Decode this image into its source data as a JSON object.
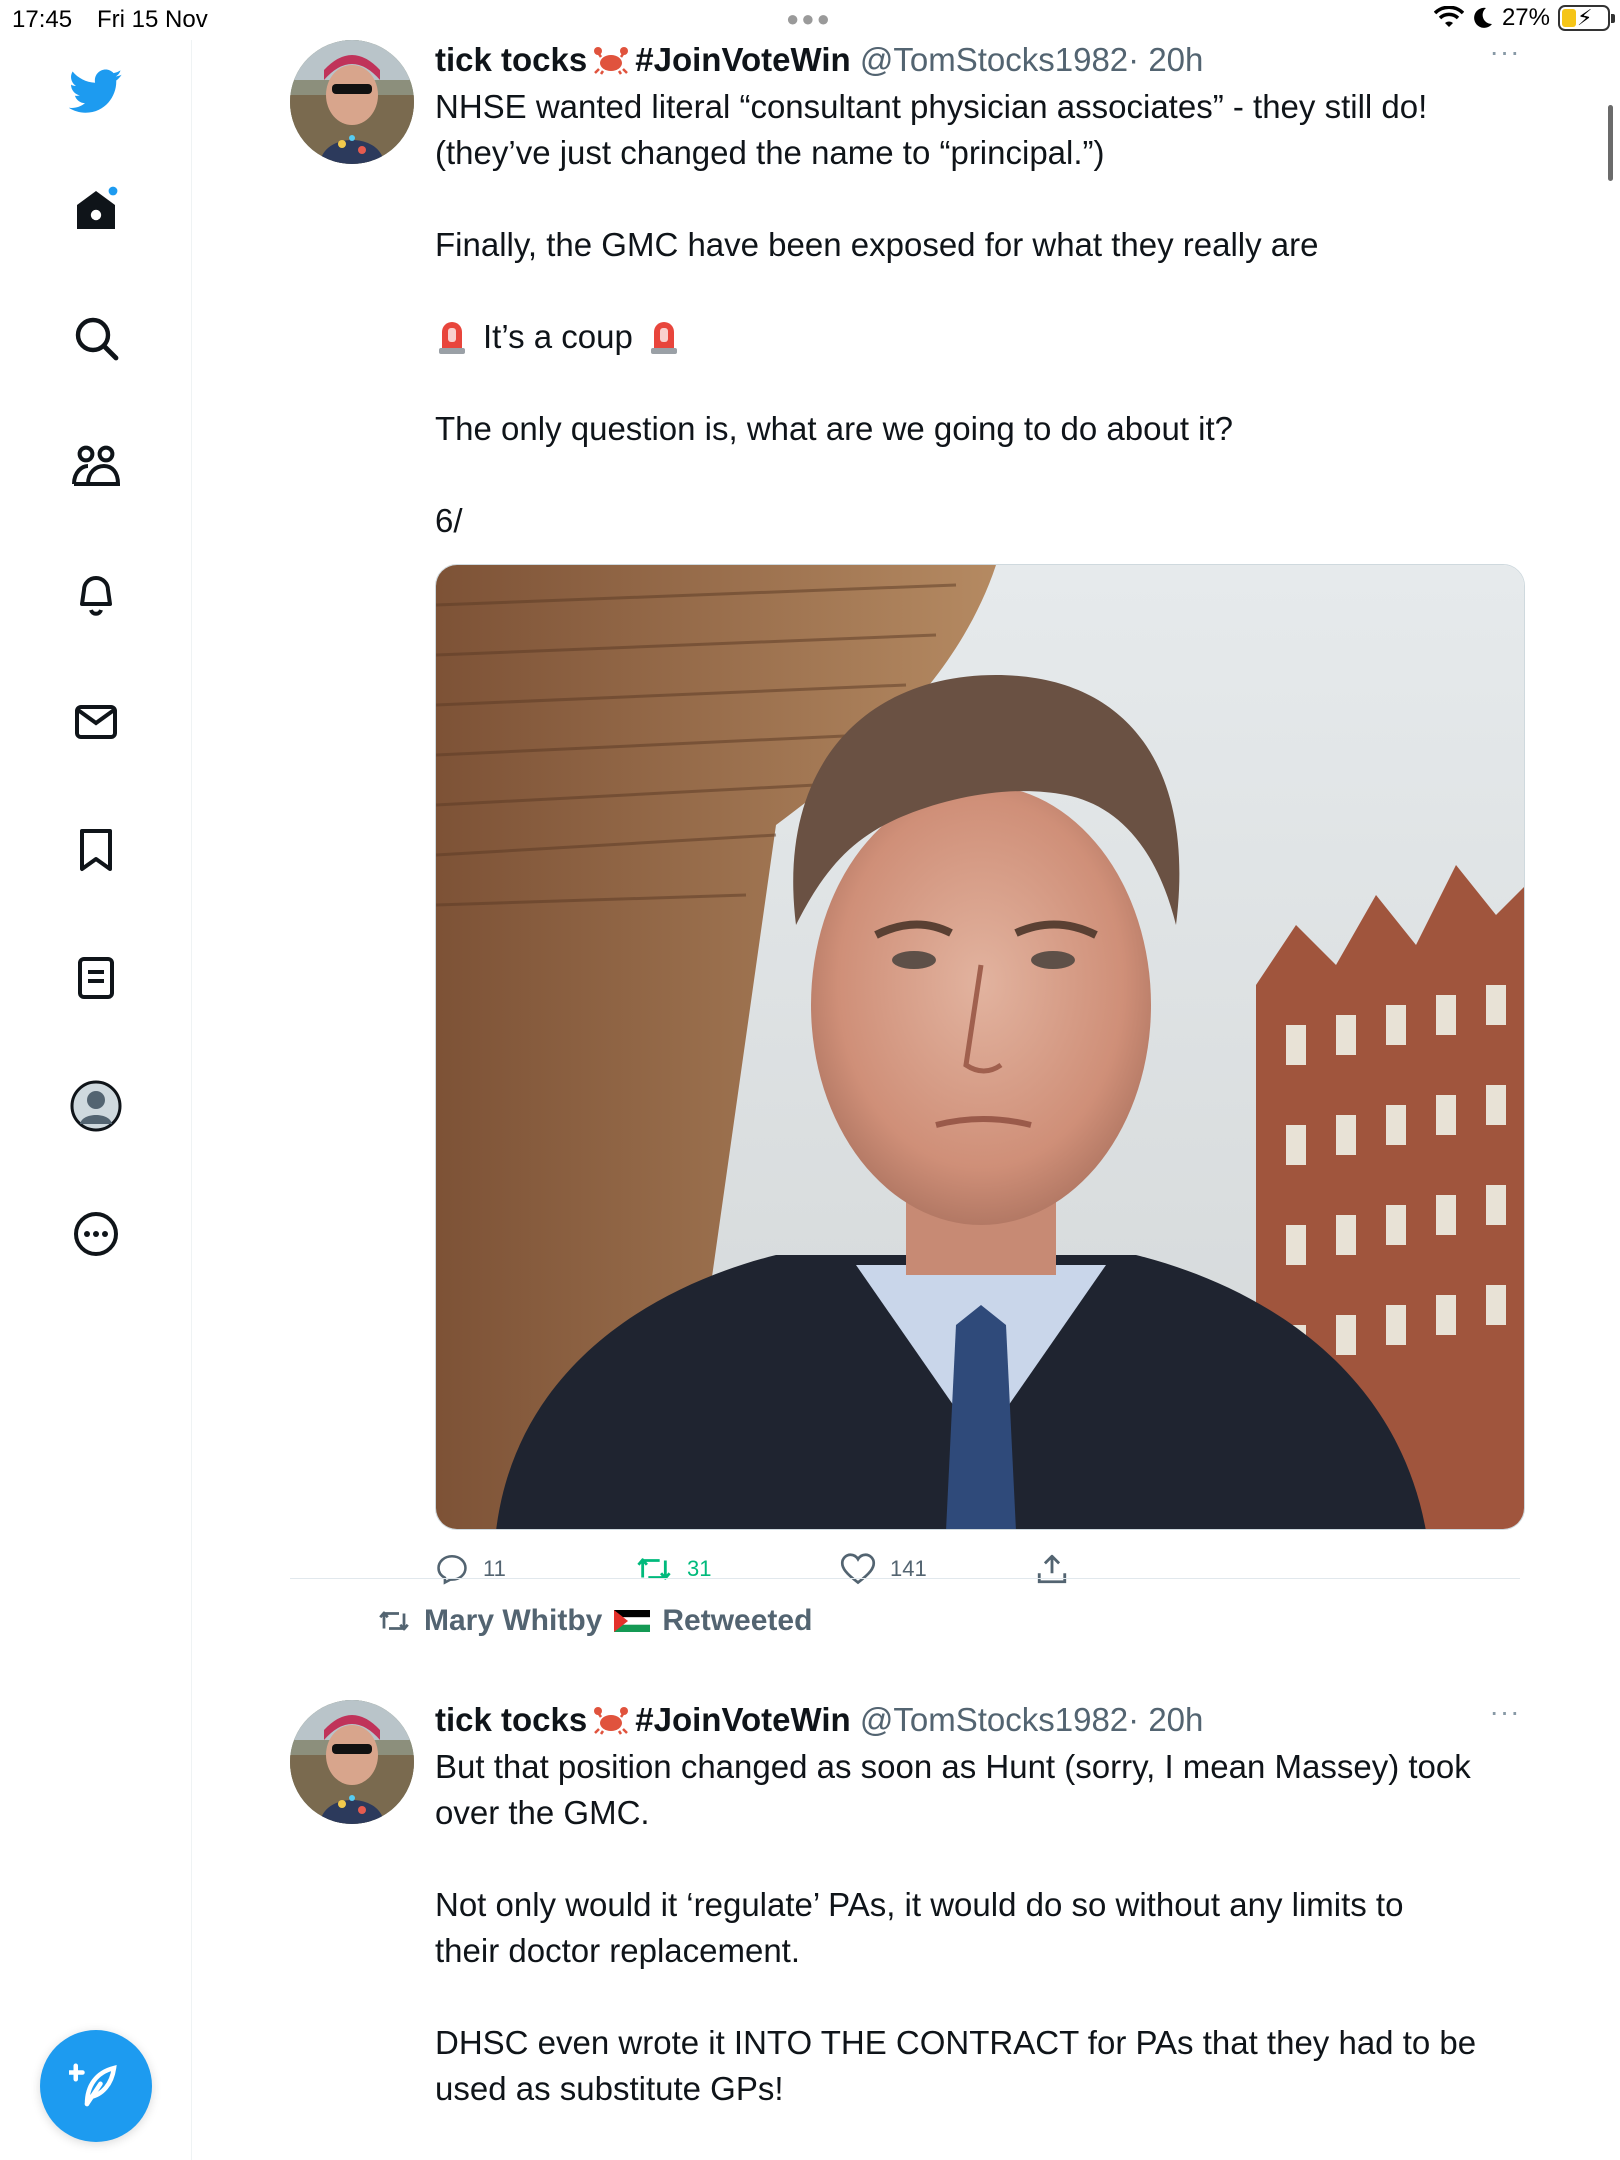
{
  "status_bar": {
    "time": "17:45",
    "date": "Fri 15 Nov",
    "battery": "27%"
  },
  "sidebar": {
    "items": [
      {
        "icon": "twitter-bird-icon"
      },
      {
        "icon": "home-icon"
      },
      {
        "icon": "search-icon"
      },
      {
        "icon": "communities-icon"
      },
      {
        "icon": "notifications-bell-icon"
      },
      {
        "icon": "messages-envelope-icon"
      },
      {
        "icon": "bookmark-icon"
      },
      {
        "icon": "lists-icon"
      },
      {
        "icon": "profile-avatar-icon"
      },
      {
        "icon": "more-circle-icon"
      }
    ],
    "compose_icon": "compose-feather-icon"
  },
  "tweets": [
    {
      "name": "tick tocks",
      "hashtag": "#JoinVoteWin",
      "handle": "@TomStocks1982",
      "time": "· 20h",
      "lines": [
        "NHSE wanted literal “consultant physician associates” - they still do!",
        "(they’ve just changed the name to “principal.”)",
        "Finally, the GMC have been exposed for what they really are",
        "It’s a coup",
        "The only question is, what are we going to do about it?",
        "6/"
      ],
      "replies": "11",
      "retweets": "31",
      "likes": "141"
    },
    {
      "retweeted_by": "Mary Whitby",
      "retweeted_label": "Retweeted",
      "name": "tick tocks",
      "hashtag": "#JoinVoteWin",
      "handle": "@TomStocks1982",
      "time": "· 20h",
      "lines": [
        "But that position changed as soon as Hunt (sorry, I mean Massey) took",
        "over the GMC.",
        "Not only would it ‘regulate’ PAs, it would do so without any limits to",
        "their doctor replacement.",
        "DHSC even wrote it INTO THE CONTRACT for PAs that they had to be",
        "used as substitute GPs!"
      ]
    }
  ],
  "colors": {
    "brand": "#1d9bf0",
    "retweet": "#00ba7c",
    "secondary_text": "#536471"
  }
}
